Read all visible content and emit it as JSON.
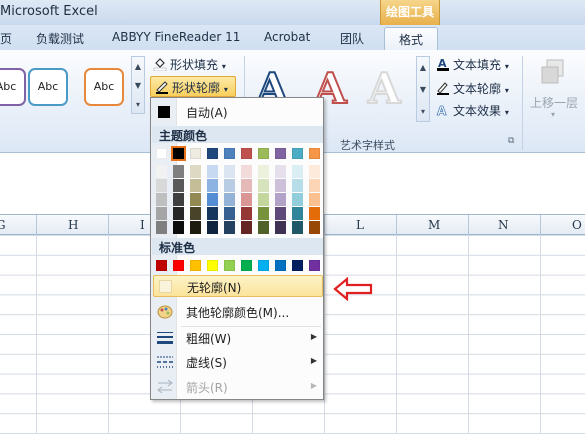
{
  "titlebar": {
    "title": "Microsoft Excel",
    "context_group": "绘图工具"
  },
  "tabs": [
    {
      "label": "页"
    },
    {
      "label": "负载测试"
    },
    {
      "label": "ABBYY FineReader 11"
    },
    {
      "label": "Acrobat"
    },
    {
      "label": "团队"
    },
    {
      "label": "格式",
      "active": true
    }
  ],
  "ribbon": {
    "shape_styles": {
      "thumb_label": "Abc",
      "thumb_colors": [
        "#7f63a6",
        "#4a9ac8",
        "#e8883a"
      ]
    },
    "shape_fill": "形状填充",
    "shape_outline": "形状轮廓",
    "wordart_group_label": "艺术字样式",
    "text_fill": "文本填充",
    "text_outline": "文本轮廓",
    "text_effects": "文本效果",
    "bring_forward": "上移一层"
  },
  "columns": [
    "G",
    "H",
    "I",
    "L",
    "M",
    "N",
    "O"
  ],
  "menu": {
    "automatic": "自动(A)",
    "theme_colors_header": "主题颜色",
    "standard_colors_header": "标准色",
    "no_outline": "无轮廓(N)",
    "more_colors": "其他轮廓颜色(M)...",
    "weight": "粗细(W)",
    "dashes": "虚线(S)",
    "arrows": "箭头(R)",
    "theme_top_row": [
      "#ffffff",
      "#000000",
      "#eeece1",
      "#1f497d",
      "#4f81bd",
      "#c0504d",
      "#9bbb59",
      "#8064a2",
      "#4bacc6",
      "#f79646"
    ],
    "theme_shades": [
      [
        "#f2f2f2",
        "#7f7f7f",
        "#ddd9c3",
        "#c6d9f0",
        "#dbe5f1",
        "#f2dcdb",
        "#ebf1dd",
        "#e5e0ec",
        "#dbeef3",
        "#fdeada"
      ],
      [
        "#d8d8d8",
        "#595959",
        "#c4bd97",
        "#8db3e2",
        "#b8cce4",
        "#e5b9b7",
        "#d7e3bc",
        "#ccc1d9",
        "#b7dde8",
        "#fbd5b5"
      ],
      [
        "#bfbfbf",
        "#3f3f3f",
        "#938953",
        "#548dd4",
        "#95b3d7",
        "#d99694",
        "#c3d69b",
        "#b2a2c7",
        "#92cddc",
        "#fac08f"
      ],
      [
        "#a5a5a5",
        "#262626",
        "#494429",
        "#17365d",
        "#366092",
        "#953734",
        "#76923c",
        "#5f497a",
        "#31859b",
        "#e36c09"
      ],
      [
        "#7f7f7f",
        "#0c0c0c",
        "#1d1b10",
        "#0f243e",
        "#244061",
        "#632423",
        "#4f6128",
        "#3f3151",
        "#205867",
        "#974806"
      ]
    ],
    "standard": [
      "#c00000",
      "#ff0000",
      "#ffc000",
      "#ffff00",
      "#92d050",
      "#00b050",
      "#00b0f0",
      "#0070c0",
      "#002060",
      "#7030a0"
    ],
    "selected_theme_color": "#000000"
  },
  "annotation_color": "#e02020"
}
